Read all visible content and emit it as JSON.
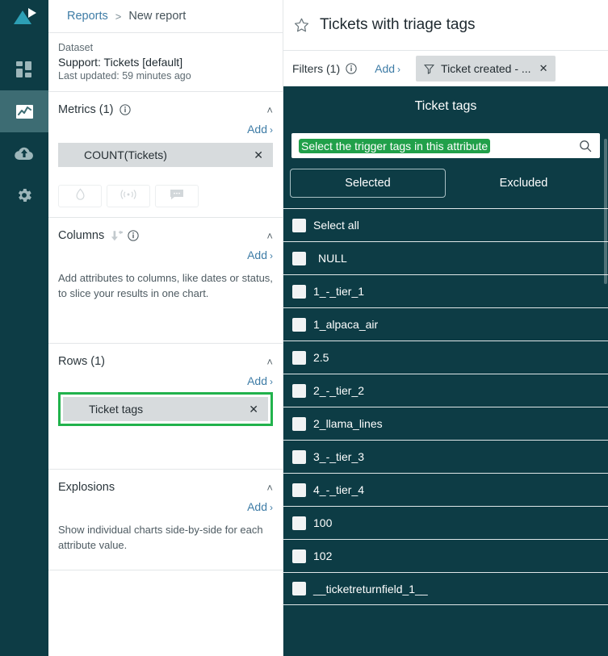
{
  "rail": {
    "logo_name": "app-logo",
    "items": [
      {
        "name": "dashboard-icon",
        "label": "Dashboard",
        "active": false
      },
      {
        "name": "analytics-icon",
        "label": "Analytics",
        "active": true
      },
      {
        "name": "cloud-upload-icon",
        "label": "Upload",
        "active": false
      },
      {
        "name": "gear-icon",
        "label": "Settings",
        "active": false
      }
    ]
  },
  "breadcrumb": {
    "root": "Reports",
    "separator": ">",
    "current": "New report"
  },
  "dataset": {
    "label": "Dataset",
    "name": "Support: Tickets [default]",
    "updated": "Last updated: 59 minutes ago"
  },
  "metrics": {
    "title": "Metrics (1)",
    "add_label": "Add",
    "caret": "›",
    "chevron": "˄",
    "chips": [
      {
        "label": "COUNT(Tickets)",
        "remove": "✕"
      }
    ],
    "mini_buttons": [
      {
        "name": "droplet-icon",
        "label": "Droplet"
      },
      {
        "name": "signal-icon",
        "label": "Signal"
      },
      {
        "name": "comment-icon",
        "label": "Comment"
      }
    ]
  },
  "columns": {
    "title": "Columns",
    "add_label": "Add",
    "caret": "›",
    "chevron": "˄",
    "description": "Add attributes to columns, like dates or status, to slice your results in one chart."
  },
  "rows": {
    "title": "Rows (1)",
    "add_label": "Add",
    "caret": "›",
    "chevron": "˄",
    "chips": [
      {
        "label": "Ticket tags",
        "remove": "✕",
        "highlighted": true
      }
    ],
    "highlight_color": "#21b24c"
  },
  "explosions": {
    "title": "Explosions",
    "add_label": "Add",
    "caret": "›",
    "chevron": "˄",
    "description": "Show individual charts side-by-side for each attribute value."
  },
  "report": {
    "title": "Tickets with triage tags",
    "star_icon": "star-outline-icon"
  },
  "filters": {
    "label": "Filters (1)",
    "add_label": "Add",
    "caret": "›",
    "chips": [
      {
        "label": "Ticket created - ...",
        "remove": "✕"
      }
    ]
  },
  "picker": {
    "title": "Ticket tags",
    "search": {
      "placeholder": "Select the trigger tags in this attribute",
      "value": "",
      "highlight_color": "#21a04a",
      "icon": "search-icon"
    },
    "tabs": [
      {
        "label": "Selected",
        "active": true
      },
      {
        "label": "Excluded",
        "active": false
      }
    ],
    "options": [
      {
        "label": "Select all",
        "checked": false,
        "indent": false
      },
      {
        "label": "NULL",
        "checked": false,
        "indent": true
      },
      {
        "label": "1_-_tier_1",
        "checked": false,
        "indent": false
      },
      {
        "label": "1_alpaca_air",
        "checked": false,
        "indent": false
      },
      {
        "label": "2.5",
        "checked": false,
        "indent": false
      },
      {
        "label": "2_-_tier_2",
        "checked": false,
        "indent": false
      },
      {
        "label": "2_llama_lines",
        "checked": false,
        "indent": false
      },
      {
        "label": "3_-_tier_3",
        "checked": false,
        "indent": false
      },
      {
        "label": "4_-_tier_4",
        "checked": false,
        "indent": false
      },
      {
        "label": "100",
        "checked": false,
        "indent": false
      },
      {
        "label": "102",
        "checked": false,
        "indent": false
      },
      {
        "label": "__ticketreturnfield_1__",
        "checked": false,
        "indent": false
      }
    ]
  },
  "colors": {
    "rail_bg": "#0d3c45",
    "rail_active": "#3d6c73",
    "picker_bg": "#0d3c45",
    "link": "#3e7ca6",
    "chip_bg": "#d7dbdd",
    "annotation_green": "#21b24c"
  }
}
